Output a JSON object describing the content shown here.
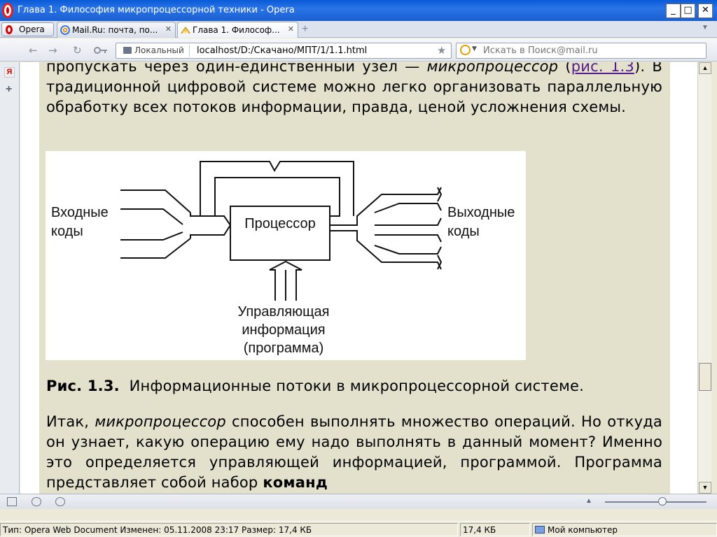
{
  "window": {
    "title": "Глава 1. Философия микропроцессорной техники - Opera",
    "min_glyph": "_",
    "max_glyph": "□",
    "close_glyph": "✕"
  },
  "tabs": {
    "menu_label": "Opera",
    "items": [
      {
        "label": "Mail.Ru: почта, по...",
        "close": "✕"
      },
      {
        "label": "Глава 1. Философ...",
        "close": "✕"
      }
    ],
    "new_tab": "+"
  },
  "address": {
    "back": "←",
    "forward": "→",
    "reload": "↻",
    "security_label": "Локальный",
    "url": "localhost/D:/Скачано/МПТ/1/1.1.html",
    "star": "★",
    "search_placeholder": "Искать в Поиск@mail.ru"
  },
  "panel": {
    "ya": "Я",
    "add": "+"
  },
  "content": {
    "p1_start": "пропускать через один-единственный узел — ",
    "p1_term": "микропроцессор",
    "p1_mid": " (",
    "p1_link": "рис. 1.3",
    "p1_end": "). В традиционной цифровой системе можно легко организовать параллельную обработку всех потоков информации, правда, ценой усложнения схемы.",
    "figure": {
      "processor": "Процессор",
      "input_line1": "Входные",
      "input_line2": "коды",
      "output_line1": "Выходные",
      "output_line2": "коды",
      "control_line1": "Управляющая",
      "control_line2": "информация",
      "control_line3": "(программа)"
    },
    "caption_num": "Рис. 1.3.",
    "caption_text": "Информационные потоки в микропроцессорной системе.",
    "p2_start": "Итак, ",
    "p2_term": "микропроцессор",
    "p2_mid": " способен выполнять множество операций. Но откуда он узнает, какую операцию ему надо выполнять в данный момент? Именно это определяется управляющей информацией, программой. Программа представляет собой набор ",
    "p2_bold": "команд"
  },
  "scrollbar": {
    "up": "▲",
    "down": "▼"
  },
  "bottom": {
    "caret": "▲"
  },
  "status": {
    "info": "Тип: Opera Web Document Изменен: 05.11.2008 23:17 Размер: 17,4 КБ",
    "size": "17,4 КБ",
    "zone": "Мой компьютер"
  },
  "colors": {
    "title_bar": "#1a5fd2",
    "page_background": "#e3e1cc",
    "link": "#551a8b"
  }
}
